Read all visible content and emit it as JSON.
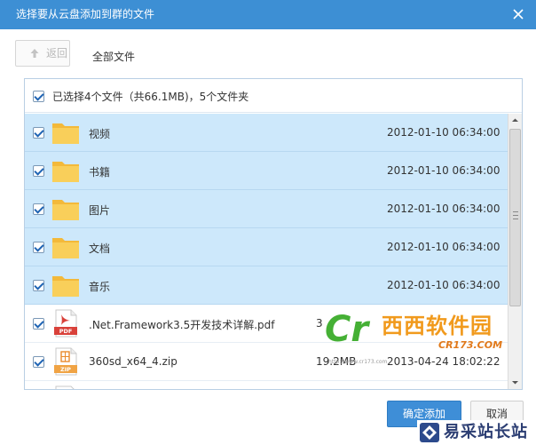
{
  "window": {
    "title": "选择要从云盘添加到群的文件",
    "close_icon": "close-icon"
  },
  "toolbar": {
    "back_label": "返回",
    "breadcrumb": "全部文件"
  },
  "list": {
    "summary": "已选择4个文件（共66.1MB)，5个文件夹",
    "rows": [
      {
        "name": "视频",
        "size": "",
        "date": "2012-01-10 06:34:00",
        "type": "folder",
        "selected": true
      },
      {
        "name": "书籍",
        "size": "",
        "date": "2012-01-10 06:34:00",
        "type": "folder",
        "selected": true
      },
      {
        "name": "图片",
        "size": "",
        "date": "2012-01-10 06:34:00",
        "type": "folder",
        "selected": true
      },
      {
        "name": "文档",
        "size": "",
        "date": "2012-01-10 06:34:00",
        "type": "folder",
        "selected": true
      },
      {
        "name": "音乐",
        "size": "",
        "date": "2012-01-10 06:34:00",
        "type": "folder",
        "selected": true
      },
      {
        "name": ".Net.Framework3.5开发技术详解.pdf",
        "size": "3",
        "date": "",
        "type": "pdf",
        "selected": false
      },
      {
        "name": "360sd_x64_4.zip",
        "size": "19.2MB",
        "date": "2013-04-24 18:02:22",
        "type": "zip",
        "selected": false
      }
    ]
  },
  "icons": {
    "pdf_label": "PDF",
    "zip_label": "ZIP"
  },
  "buttons": {
    "ok": "确定添加",
    "cancel": "取消"
  },
  "watermarks": {
    "cr_logo": "Cr",
    "cr_name": "西西软件园",
    "cr_domain": "CR173.COM",
    "cr_url": "http://www.cr173.com",
    "yc_name": "易采站长站"
  },
  "colors": {
    "titlebar": "#3d8fd4",
    "row_selected": "#cde8fb",
    "folder": "#f9c84a",
    "primary_button": "#3e8ed7"
  }
}
